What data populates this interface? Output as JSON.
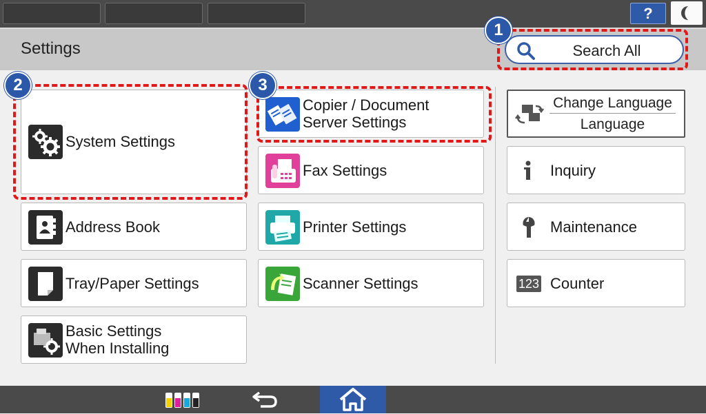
{
  "topbar": {
    "help_label": "?",
    "help_icon": "question-mark-icon",
    "night_icon": "crescent-moon-icon"
  },
  "header": {
    "title": "Settings",
    "search_label": "Search All",
    "search_icon": "magnifier-icon"
  },
  "badges": [
    "1",
    "2",
    "3"
  ],
  "left_column": [
    {
      "label": "System Settings",
      "icon": "gears-icon"
    },
    {
      "label": "Address Book",
      "icon": "address-book-icon"
    },
    {
      "label": "Tray/Paper Settings",
      "icon": "paper-sheet-icon"
    },
    {
      "label": "Basic Settings\nWhen Installing",
      "icon": "printer-gear-icon"
    }
  ],
  "middle_column": [
    {
      "label": "Copier / Document\nServer Settings",
      "icon": "copier-documents-icon"
    },
    {
      "label": "Fax Settings",
      "icon": "fax-machine-icon"
    },
    {
      "label": "Printer Settings",
      "icon": "printer-icon"
    },
    {
      "label": "Scanner Settings",
      "icon": "scanner-icon"
    }
  ],
  "right_column": {
    "language": {
      "line1": "Change Language",
      "line2": "Language",
      "icon": "language-switch-icon"
    },
    "items": [
      {
        "label": "Inquiry",
        "icon": "info-icon"
      },
      {
        "label": "Maintenance",
        "icon": "wrench-icon"
      },
      {
        "label": "Counter",
        "icon": "counter-123-icon",
        "icon_text": "123"
      }
    ]
  },
  "bottombar": {
    "toner_icon": "toner-levels-icon",
    "back_icon": "back-arrow-icon",
    "home_icon": "home-icon"
  },
  "colors": {
    "accent_blue": "#2f5aa8",
    "callout_red": "#e01818",
    "copier_icon_bg": "#1f5fd0",
    "fax_icon_bg": "#e0409a",
    "printer_icon_bg": "#20a8a8",
    "scanner_icon_bg": "#3aa63a",
    "system_icon_bg": "#2b2b2b"
  }
}
